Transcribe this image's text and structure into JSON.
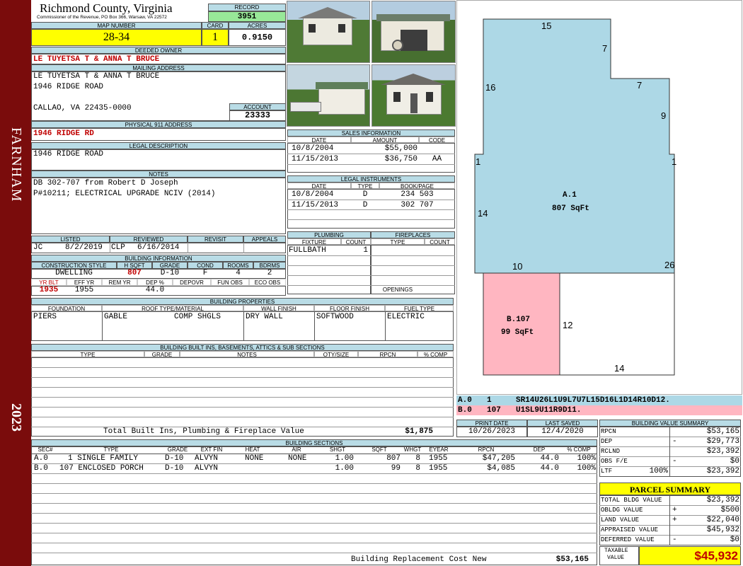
{
  "county": {
    "name": "Richmond County, Virginia",
    "commissioner": "Commissioner of the Revenue, PO Box 366, Warsaw, VA 22572"
  },
  "sidebar": {
    "district": "FARNHAM",
    "year": "2023"
  },
  "record": {
    "label": "RECORD",
    "value": "3951"
  },
  "map_number": {
    "label": "MAP NUMBER",
    "value": "28-34"
  },
  "card": {
    "label": "CARD",
    "value": "1"
  },
  "acres": {
    "label": "ACRES",
    "value": "0.9150"
  },
  "deeded_owner": {
    "label": "DEEDED OWNER",
    "value": "LE TUYETSA T & ANNA T BRUCE"
  },
  "mailing_address": {
    "label": "MAILING ADDRESS",
    "line1": "LE TUYETSA T & ANNA T BRUCE",
    "line2": "1946 RIDGE ROAD",
    "line3": "CALLAO, VA 22435-0000"
  },
  "account": {
    "label": "ACCOUNT",
    "value": "23333"
  },
  "physical_address": {
    "label": "PHYSICAL 911 ADDRESS",
    "value": "1946 RIDGE RD"
  },
  "legal_description": {
    "label": "LEGAL DESCRIPTION",
    "value": "1946 RIDGE ROAD"
  },
  "notes": {
    "label": "NOTES",
    "line1": "DB 302-707 from Robert D Joseph",
    "line2": "P#10211; ELECTRICAL UPGRADE NCIV (2014)"
  },
  "status": {
    "listed_label": "LISTED",
    "listed_by": "JC",
    "listed_date": "8/2/2019",
    "reviewed_label": "REVIEWED",
    "reviewed_by": "CLP",
    "reviewed_date": "6/16/2014",
    "revisit_label": "REVISIT",
    "appeals_label": "APPEALS"
  },
  "building_info": {
    "label": "BUILDING INFORMATION",
    "headers": [
      "CONSTRUCTION STYLE",
      "H SQFT",
      "GRADE",
      "COND",
      "ROOMS",
      "BDRMS"
    ],
    "values": [
      "DWELLING",
      "807",
      "D-10",
      "F",
      "4",
      "2"
    ],
    "headers2": [
      "YR BLT",
      "EFF YR",
      "REM YR",
      "DEP %",
      "DEPOVR",
      "FUN OBS",
      "ECO OBS"
    ],
    "values2": [
      "1935",
      "1955",
      "",
      "44.0",
      "",
      "",
      ""
    ]
  },
  "sales": {
    "label": "SALES INFORMATION",
    "headers": [
      "DATE",
      "AMOUNT",
      "CODE"
    ],
    "rows": [
      {
        "date": "10/8/2004",
        "amount": "$55,000",
        "code": ""
      },
      {
        "date": "11/15/2013",
        "amount": "$36,750",
        "code": "AA"
      }
    ]
  },
  "legal_instruments": {
    "label": "LEGAL INSTRUMENTS",
    "headers": [
      "DATE",
      "TYPE",
      "BOOK/PAGE"
    ],
    "rows": [
      {
        "date": "10/8/2004",
        "type": "D",
        "book": "234 503"
      },
      {
        "date": "11/15/2013",
        "type": "D",
        "book": "302 707"
      }
    ]
  },
  "plumbing": {
    "label": "PLUMBING",
    "headers": [
      "FIXTURE",
      "COUNT"
    ],
    "rows": [
      {
        "fixture": "FULLBATH",
        "count": "1"
      }
    ]
  },
  "fireplaces": {
    "label": "FIREPLACES",
    "headers": [
      "TYPE",
      "COUNT"
    ],
    "openings_label": "OPENINGS"
  },
  "building_properties": {
    "label": "BUILDING PROPERTIES",
    "headers": [
      "FOUNDATION",
      "ROOF TYPE/MATERIAL",
      "WALL FINISH",
      "FLOOR FINISH",
      "FUEL TYPE"
    ],
    "foundation": "PIERS",
    "roof_type": "GABLE",
    "roof_material": "COMP SHGLS",
    "wall": "DRY WALL",
    "floor": "SOFTWOOD",
    "fuel": "ELECTRIC"
  },
  "built_ins": {
    "label": "BUILDING BUILT INS, BASEMENTS, ATTICS & SUB SECTIONS",
    "headers": [
      "TYPE",
      "GRADE",
      "NOTES",
      "QTY/SIZE",
      "RPCN",
      "% COMP"
    ],
    "total_label": "Total Built Ins, Plumbing & Fireplace Value",
    "total_value": "$1,875"
  },
  "sketch": {
    "section_a": {
      "label": "A.1",
      "area": "807 SqFt"
    },
    "section_b": {
      "label": "B.107",
      "area": "99 SqFt"
    },
    "dims": [
      "15",
      "7",
      "7",
      "9",
      "16",
      "1",
      "1",
      "14",
      "26",
      "10",
      "12",
      "14"
    ],
    "legend": [
      {
        "id": "A.0",
        "code": "1",
        "path": "SR14U26L1U9L7U7L15D16L1D14R10D12."
      },
      {
        "id": "B.0",
        "code": "107",
        "path": "U1SL9U11R9D11."
      }
    ]
  },
  "print_info": {
    "print_label": "PRINT DATE",
    "print_date": "10/26/2023",
    "saved_label": "LAST SAVED",
    "saved_date": "12/4/2020"
  },
  "value_summary": {
    "label": "BUILDING VALUE SUMMARY",
    "rows": [
      {
        "name": "RPCN",
        "sign": "",
        "pct": "",
        "value": "$53,165"
      },
      {
        "name": "DEP",
        "sign": "-",
        "pct": "",
        "value": "$29,773"
      },
      {
        "name": "RCLND",
        "sign": "",
        "pct": "",
        "value": "$23,392"
      },
      {
        "name": "OBS F/E",
        "sign": "-",
        "pct": "",
        "value": "$0"
      },
      {
        "name": "LTF",
        "sign": "",
        "pct": "100%",
        "value": "$23,392"
      }
    ]
  },
  "parcel_summary": {
    "label": "PARCEL SUMMARY",
    "rows": [
      {
        "name": "TOTAL BLDG VALUE",
        "sign": "",
        "value": "$23,392"
      },
      {
        "name": "OBLDG VALUE",
        "sign": "+",
        "value": "$500"
      },
      {
        "name": "LAND VALUE",
        "sign": "+",
        "value": "$22,040"
      },
      {
        "name": "APPRAISED VALUE",
        "sign": "",
        "value": "$45,932"
      },
      {
        "name": "DEFERRED VALUE",
        "sign": "-",
        "value": "$0"
      }
    ],
    "taxable_label_1": "TAXABLE",
    "taxable_label_2": "VALUE",
    "taxable_value": "$45,932"
  },
  "building_sections": {
    "label": "BUILDING SECTIONS",
    "headers": [
      "SEC#",
      "TYPE",
      "GRADE",
      "EXT FIN",
      "HEAT",
      "AIR",
      "SHGT",
      "SQFT",
      "WHGT",
      "EYEAR",
      "RPCN",
      "DEP",
      "% COMP"
    ],
    "rows": [
      [
        "A.0",
        "1 SINGLE FAMILY",
        "D-10",
        "ALVYN",
        "NONE",
        "NONE",
        "1.00",
        "807",
        "8",
        "1955",
        "$47,205",
        "44.0",
        "100%"
      ],
      [
        "B.0",
        "107 ENCLOSED PORCH",
        "D-10",
        "ALVYN",
        "",
        "",
        "1.00",
        "99",
        "8",
        "1955",
        "$4,085",
        "44.0",
        "100%"
      ]
    ],
    "rcn_label": "Building Replacement Cost New",
    "rcn_value": "$53,165"
  },
  "colors": {
    "sidebar": "#7a0c0c",
    "header": "#b9dce6",
    "yellow": "#ffff00",
    "record": "#98e898",
    "sketch_a": "#add8e6",
    "sketch_b": "#ffb6c1"
  }
}
